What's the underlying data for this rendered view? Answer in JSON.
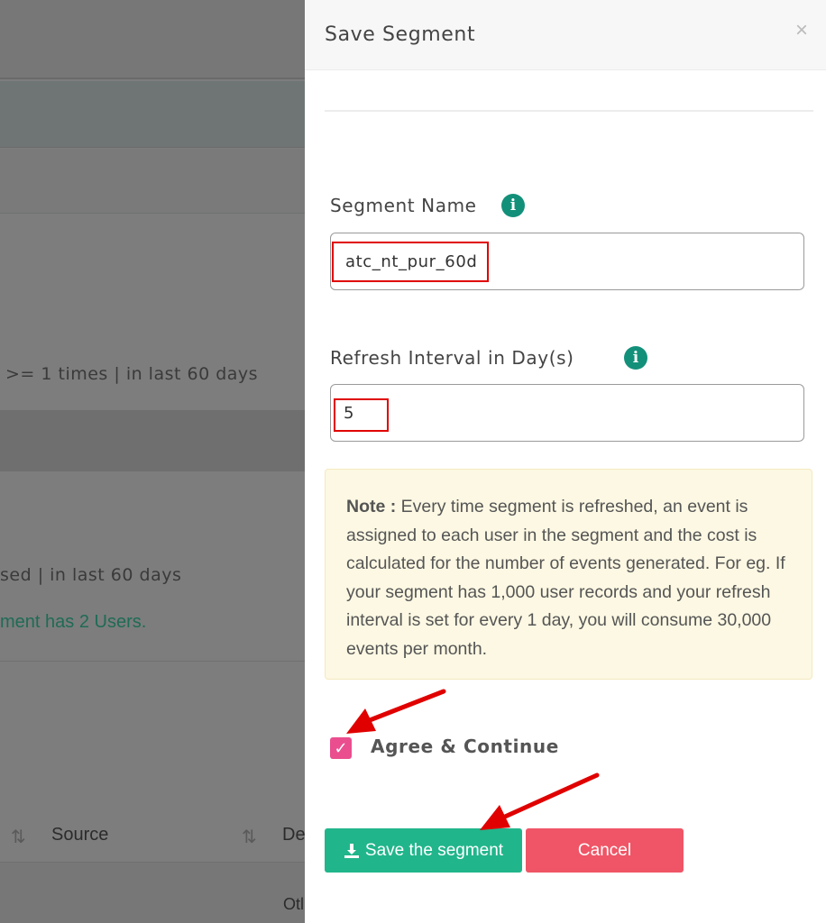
{
  "background": {
    "rule_text": ">= 1 times | in last 60 days",
    "rule_text_2": "sed | in last 60 days",
    "count_text": "ment has 2 Users.",
    "table_headers": [
      "Source",
      "De"
    ],
    "table_cell": "Otl"
  },
  "drawer": {
    "title": "Save Segment",
    "close_symbol": "×",
    "segment_name_label": "Segment Name",
    "segment_name_value": "atc_nt_pur_60d",
    "refresh_label": "Refresh Interval in Day(s)",
    "refresh_value": "5",
    "info_symbol": "i",
    "note_bold": "Note :",
    "note_text": " Every time segment is refreshed, an event is assigned to each user in the segment and the cost is calculated for the number of events generated. For eg. If your segment has 1,000 user records and your refresh interval is set for every 1 day, you will consume 30,000 events per month.",
    "agree_label": "Agree & Continue",
    "checkbox_checked": true,
    "save_label": "Save the segment",
    "cancel_label": "Cancel"
  },
  "colors": {
    "accent_teal": "#13907a",
    "save_button": "#21b58b",
    "cancel_button": "#ef5566",
    "checkbox": "#ea4e8e",
    "note_bg": "#fcf8e3",
    "annotation_red": "#e00000"
  },
  "icons": {
    "close": "close-icon",
    "info": "info-icon",
    "checkbox": "check-icon",
    "save": "download-icon",
    "sort": "sort-icon"
  }
}
